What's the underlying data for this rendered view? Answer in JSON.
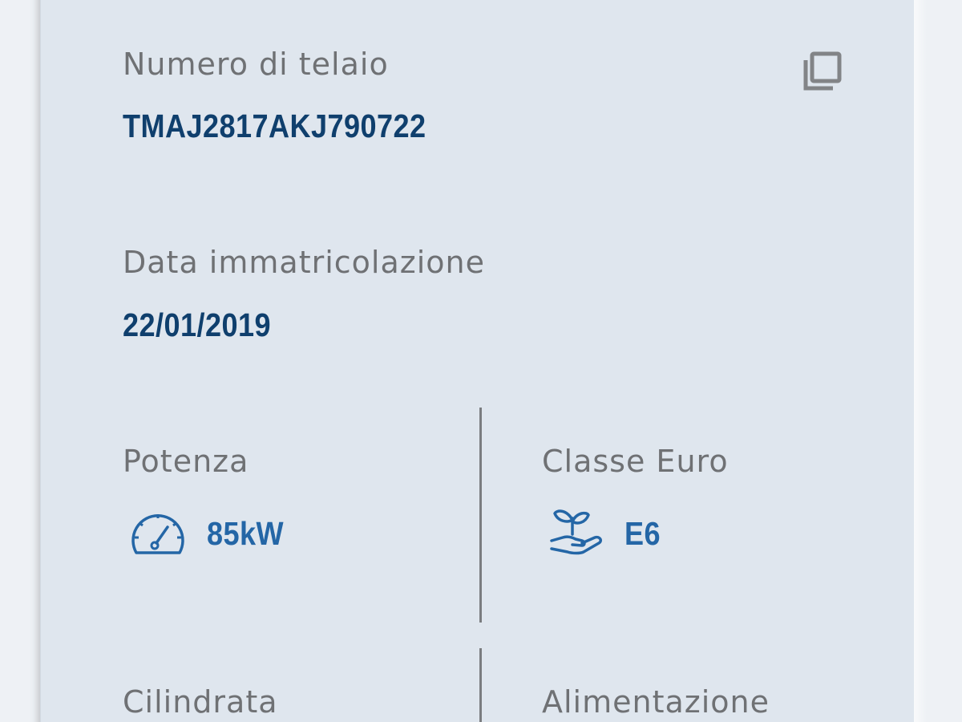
{
  "vehicle_details": {
    "vin": {
      "label": "Numero di telaio",
      "value": "TMAJ2817AKJ790722",
      "copy_icon": "copy-icon"
    },
    "registration_date": {
      "label": "Data immatricolazione",
      "value": "22/01/2019"
    },
    "power": {
      "label": "Potenza",
      "value": "85kW",
      "icon": "speedometer-icon"
    },
    "euro_class": {
      "label": "Classe Euro",
      "value": "E6",
      "icon": "plant-hand-icon"
    },
    "displacement": {
      "label": "Cilindrata"
    },
    "fuel": {
      "label": "Alimentazione"
    }
  },
  "colors": {
    "card_background": "#dfe6ee",
    "primary_value": "#0f3f6d",
    "accent_value": "#2466a6",
    "label": "#6f7174"
  }
}
